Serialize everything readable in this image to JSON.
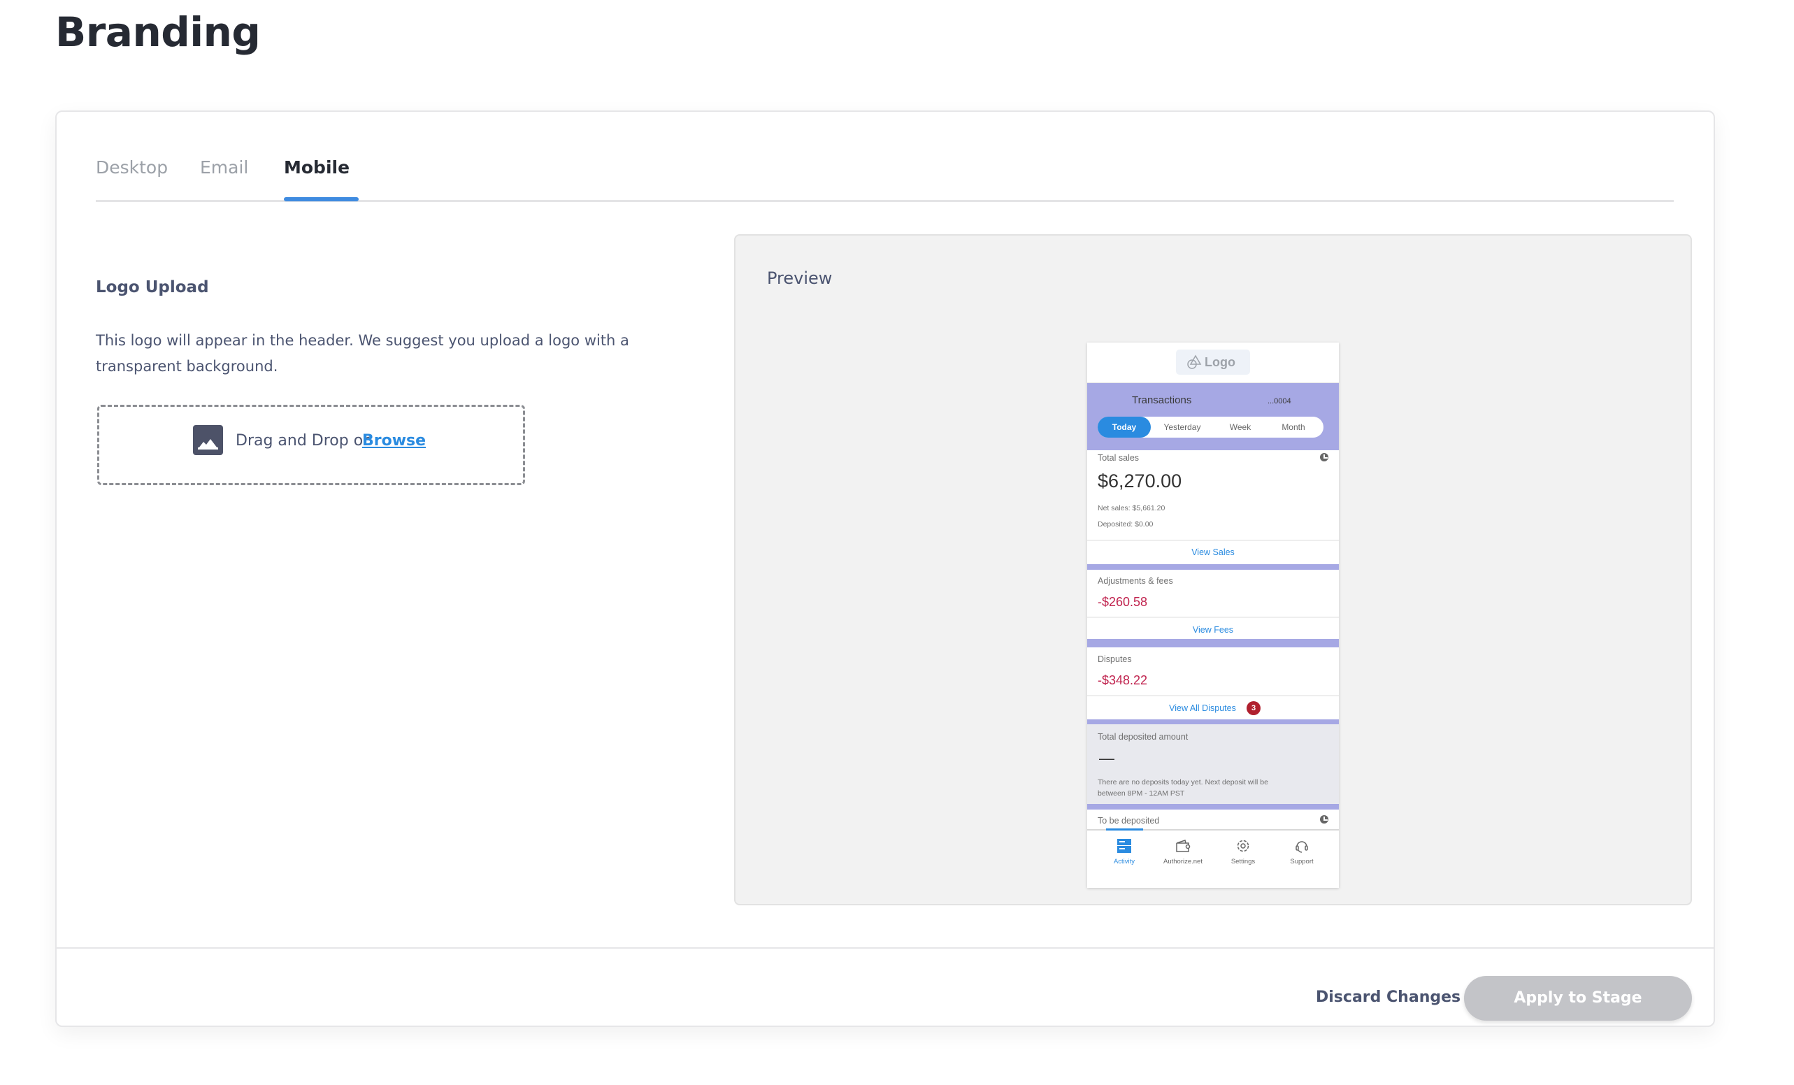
{
  "page": {
    "title": "Branding"
  },
  "tabs": [
    {
      "label": "Desktop",
      "active": false
    },
    {
      "label": "Email",
      "active": false
    },
    {
      "label": "Mobile",
      "active": true
    }
  ],
  "logo_upload": {
    "title": "Logo Upload",
    "description": "This logo will appear in the header. We suggest you upload a logo with a transparent background.",
    "dropzone_text": "Drag and Drop or",
    "browse_label": "Browse",
    "icon": "image-icon"
  },
  "preview": {
    "title": "Preview",
    "phone": {
      "logo_label": "Logo",
      "logo_icon": "shapes-icon",
      "header_title": "Transactions",
      "account": "...0004",
      "periods": [
        "Today",
        "Yesterday",
        "Week",
        "Month"
      ],
      "active_period": "Today",
      "total_sales": {
        "label": "Total sales",
        "amount": "$6,270.00",
        "net_sales": "Net sales: $5,661.20",
        "deposited": "Deposited: $0.00",
        "link": "View Sales"
      },
      "adjustments": {
        "label": "Adjustments & fees",
        "amount": "-$260.58",
        "link": "View Fees"
      },
      "disputes": {
        "label": "Disputes",
        "amount": "-$348.22",
        "link": "View All Disputes",
        "badge_count": "3"
      },
      "total_deposited": {
        "label": "Total deposited amount",
        "value": "—",
        "note_line1": "There are no deposits today yet. Next deposit will be",
        "note_line2": "between 8PM - 12AM PST"
      },
      "to_be_deposited": {
        "label": "To be deposited"
      },
      "nav": [
        {
          "label": "Activity",
          "icon": "activity-icon",
          "active": true
        },
        {
          "label": "Authorize.net",
          "icon": "wallet-icon",
          "active": false
        },
        {
          "label": "Settings",
          "icon": "gear-icon",
          "active": false
        },
        {
          "label": "Support",
          "icon": "headset-icon",
          "active": false
        }
      ]
    }
  },
  "footer": {
    "discard_label": "Discard Changes",
    "apply_label": "Apply to Stage"
  },
  "colors": {
    "accent": "#2a8be0",
    "tab_underline": "#3f8be0",
    "phone_band": "#a6a8e4",
    "negative": "#c0234e",
    "apply_disabled": "#c3c4c8"
  }
}
